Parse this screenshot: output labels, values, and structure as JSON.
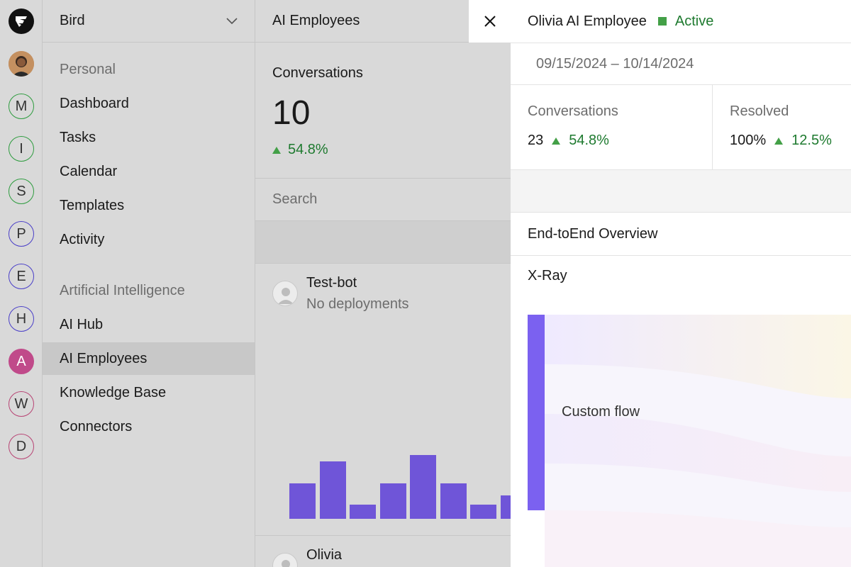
{
  "rail": {
    "logo_icon": "bird-logo-icon",
    "workspaces": [
      {
        "letter": "M",
        "color": "#2e9c3f"
      },
      {
        "letter": "I",
        "color": "#2e9c3f"
      },
      {
        "letter": "S",
        "color": "#2e9c3f"
      },
      {
        "letter": "P",
        "color": "#4a3fc8"
      },
      {
        "letter": "E",
        "color": "#4a3fc8"
      },
      {
        "letter": "H",
        "color": "#4a3fc8"
      },
      {
        "letter": "A",
        "color": "#c04a8a",
        "filled": true
      },
      {
        "letter": "W",
        "color": "#b84474"
      },
      {
        "letter": "D",
        "color": "#b84474"
      }
    ]
  },
  "nav": {
    "workspace_name": "Bird",
    "section_personal": "Personal",
    "items_personal": [
      "Dashboard",
      "Tasks",
      "Calendar",
      "Templates",
      "Activity"
    ],
    "section_ai": "Artificial Intelligence",
    "items_ai": [
      "AI Hub",
      "AI Employees",
      "Knowledge Base",
      "Connectors"
    ],
    "active_item": "AI Employees"
  },
  "list": {
    "title": "AI Employees",
    "metric_label": "Conversations",
    "metric_value": "10",
    "metric_delta": "54.8%",
    "search_placeholder": "Search",
    "bots": [
      {
        "name": "Test-bot",
        "sub": "No deployments"
      },
      {
        "name": "Olivia",
        "sub": ""
      }
    ],
    "bar_values": [
      0.54,
      0.88,
      0.22,
      0.54,
      0.98,
      0.54,
      0.22,
      0.36
    ]
  },
  "detail": {
    "name": "Olivia AI Employee",
    "status": "Active",
    "status_color": "#43a047",
    "date_range": "09/15/2024 – 10/14/2024",
    "stats": [
      {
        "label": "Conversations",
        "value": "23",
        "delta": "54.8%"
      },
      {
        "label": "Resolved",
        "value": "100%",
        "delta": "12.5%"
      }
    ],
    "overview_label": "End-toEnd Overview",
    "xray_label": "X-Ray",
    "flow_label": "Custom flow",
    "accent": "#7b61f0"
  }
}
